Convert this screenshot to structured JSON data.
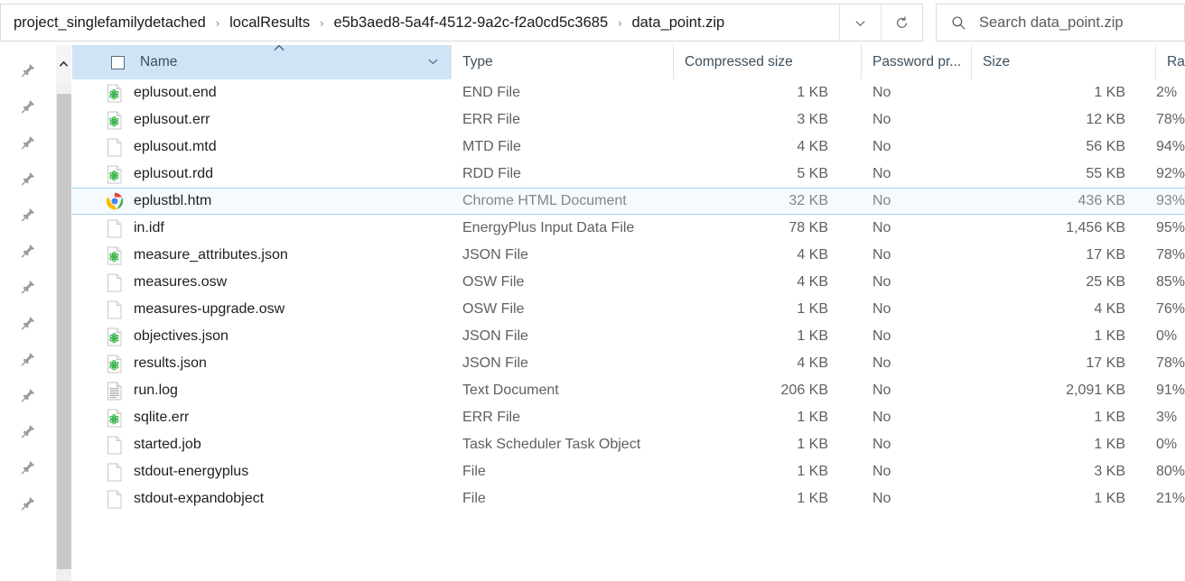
{
  "address": {
    "breadcrumbs": [
      "project_singlefamilydetached",
      "localResults",
      "e5b3aed8-5a4f-4512-9a2c-f2a0cd5c3685",
      "data_point.zip"
    ],
    "separator": "›",
    "dropdown_icon": "chevron-down-icon",
    "refresh_icon": "refresh-icon"
  },
  "search": {
    "placeholder": "Search data_point.zip",
    "value": "",
    "icon": "search-icon"
  },
  "columns": {
    "name": "Name",
    "type": "Type",
    "compressed_size": "Compressed size",
    "password_protected": "Password pr...",
    "size": "Size",
    "ratio": "Ratio",
    "sort_indicator": "sort-ascending-caret",
    "name_dropdown_icon": "chevron-down-icon",
    "select_all_checkbox": "select-all-checkbox"
  },
  "sidebar": {
    "pin_icon": "pin-icon",
    "pin_count": 13
  },
  "scrollbar": {
    "up_arrow_icon": "scroll-up-arrow-icon"
  },
  "files": [
    {
      "name": "eplusout.end",
      "icon": "notepadpp-file-icon",
      "type": "END File",
      "compressed_size": "1 KB",
      "password": "No",
      "size": "1 KB",
      "ratio": "2%",
      "selected": false
    },
    {
      "name": "eplusout.err",
      "icon": "notepadpp-file-icon",
      "type": "ERR File",
      "compressed_size": "3 KB",
      "password": "No",
      "size": "12 KB",
      "ratio": "78%",
      "selected": false
    },
    {
      "name": "eplusout.mtd",
      "icon": "blank-file-icon",
      "type": "MTD File",
      "compressed_size": "4 KB",
      "password": "No",
      "size": "56 KB",
      "ratio": "94%",
      "selected": false
    },
    {
      "name": "eplusout.rdd",
      "icon": "notepadpp-file-icon",
      "type": "RDD File",
      "compressed_size": "5 KB",
      "password": "No",
      "size": "55 KB",
      "ratio": "92%",
      "selected": false
    },
    {
      "name": "eplustbl.htm",
      "icon": "chrome-icon",
      "type": "Chrome HTML Document",
      "compressed_size": "32 KB",
      "password": "No",
      "size": "436 KB",
      "ratio": "93%",
      "selected": true
    },
    {
      "name": "in.idf",
      "icon": "blank-file-icon",
      "type": "EnergyPlus Input Data File",
      "compressed_size": "78 KB",
      "password": "No",
      "size": "1,456 KB",
      "ratio": "95%",
      "selected": false
    },
    {
      "name": "measure_attributes.json",
      "icon": "notepadpp-file-icon",
      "type": "JSON File",
      "compressed_size": "4 KB",
      "password": "No",
      "size": "17 KB",
      "ratio": "78%",
      "selected": false
    },
    {
      "name": "measures.osw",
      "icon": "blank-file-icon",
      "type": "OSW File",
      "compressed_size": "4 KB",
      "password": "No",
      "size": "25 KB",
      "ratio": "85%",
      "selected": false
    },
    {
      "name": "measures-upgrade.osw",
      "icon": "blank-file-icon",
      "type": "OSW File",
      "compressed_size": "1 KB",
      "password": "No",
      "size": "4 KB",
      "ratio": "76%",
      "selected": false
    },
    {
      "name": "objectives.json",
      "icon": "notepadpp-file-icon",
      "type": "JSON File",
      "compressed_size": "1 KB",
      "password": "No",
      "size": "1 KB",
      "ratio": "0%",
      "selected": false
    },
    {
      "name": "results.json",
      "icon": "notepadpp-file-icon",
      "type": "JSON File",
      "compressed_size": "4 KB",
      "password": "No",
      "size": "17 KB",
      "ratio": "78%",
      "selected": false
    },
    {
      "name": "run.log",
      "icon": "text-document-icon",
      "type": "Text Document",
      "compressed_size": "206 KB",
      "password": "No",
      "size": "2,091 KB",
      "ratio": "91%",
      "selected": false
    },
    {
      "name": "sqlite.err",
      "icon": "notepadpp-file-icon",
      "type": "ERR File",
      "compressed_size": "1 KB",
      "password": "No",
      "size": "1 KB",
      "ratio": "3%",
      "selected": false
    },
    {
      "name": "started.job",
      "icon": "blank-file-icon",
      "type": "Task Scheduler Task Object",
      "compressed_size": "1 KB",
      "password": "No",
      "size": "1 KB",
      "ratio": "0%",
      "selected": false
    },
    {
      "name": "stdout-energyplus",
      "icon": "blank-file-icon",
      "type": "File",
      "compressed_size": "1 KB",
      "password": "No",
      "size": "3 KB",
      "ratio": "80%",
      "selected": false
    },
    {
      "name": "stdout-expandobject",
      "icon": "blank-file-icon",
      "type": "File",
      "compressed_size": "1 KB",
      "password": "No",
      "size": "1 KB",
      "ratio": "21%",
      "selected": false
    }
  ],
  "colors": {
    "header_highlight": "#cfe4f7",
    "selection_border": "#a8d3ef",
    "scrollbar_thumb": "#c9c9c9",
    "text_primary": "#1f1f1f",
    "text_secondary": "#5f5f5f"
  }
}
